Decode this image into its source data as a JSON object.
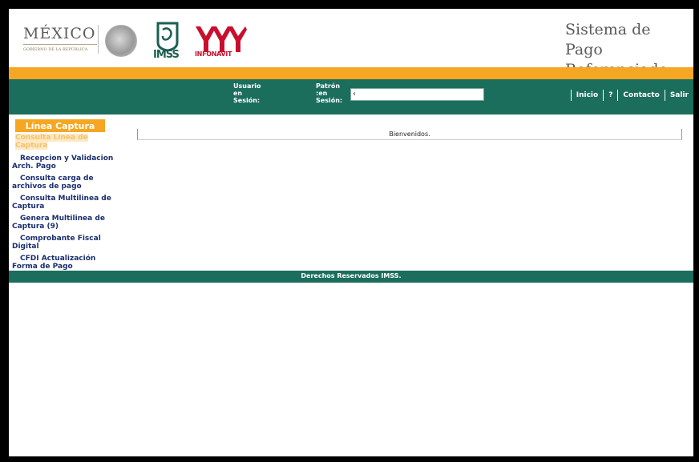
{
  "header": {
    "gov_logo_word": "MÉXICO",
    "gov_logo_sub": "GOBIERNO DE LA REPÚBLICA",
    "imss_label": "IMSS",
    "infonavit_label": "INFONAVIT",
    "app_title_line1": "Sistema de Pago",
    "app_title_line2": "Referenciado"
  },
  "session_bar": {
    "user_label": [
      "Usuario",
      "en",
      "Sesión:"
    ],
    "patron_label": [
      "Patrón",
      ":en",
      "Sesión:"
    ],
    "nav": [
      "Inicio",
      "?",
      "Contacto",
      "Salir"
    ]
  },
  "sidebar": {
    "header": "Línea Captura",
    "active_item": "Consulta Línea de Captura",
    "items": [
      "Recepcion y Validacion Arch. Pago",
      "Consulta carga de archivos de pago",
      "Consulta Multilinea de Captura",
      "Genera Multilinea de Captura (9)",
      "Comprobante Fiscal Digital",
      "CFDI Actualización Forma de Pago"
    ]
  },
  "main": {
    "welcome": "Bienvenidos."
  },
  "footer": {
    "text": "Derechos Reservados IMSS."
  },
  "colors": {
    "green": "#1b6d5c",
    "orange": "#f5a623",
    "link_blue": "#1a2e6e"
  }
}
